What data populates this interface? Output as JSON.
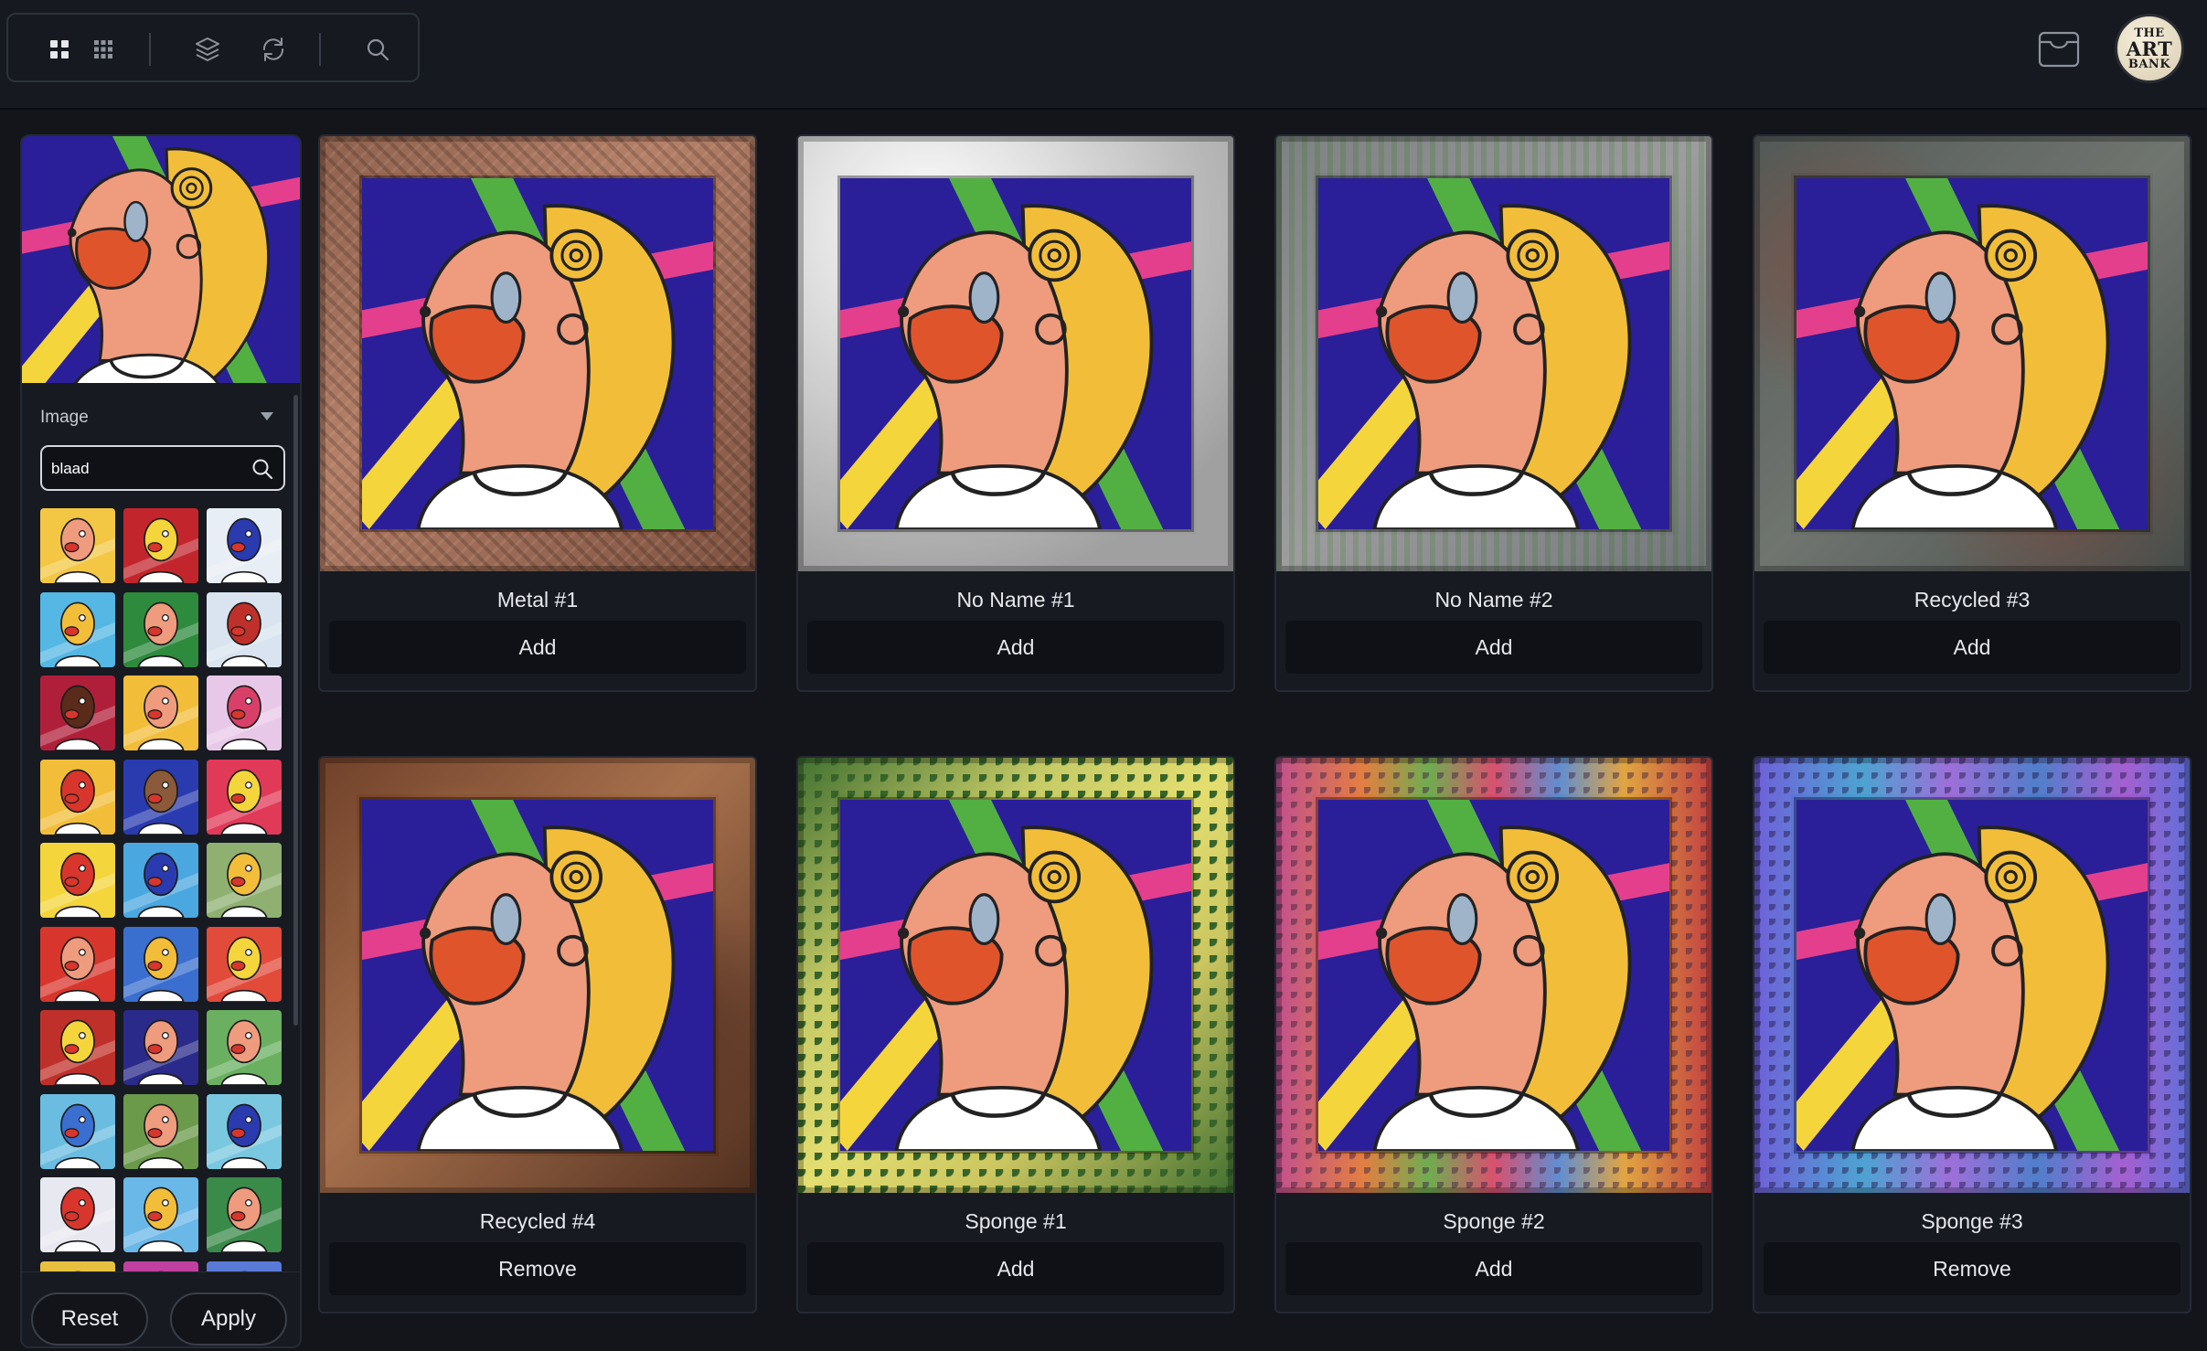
{
  "toolbar": {
    "icons": [
      "grid-large-icon",
      "grid-small-icon",
      "layers-icon",
      "refresh-icon",
      "search-icon"
    ]
  },
  "header": {
    "wallet_icon": "wallet-icon",
    "logo_lines": [
      "THE",
      "ART",
      "BANK"
    ]
  },
  "sidebar": {
    "section_label": "Image",
    "search": {
      "value": "blaad"
    },
    "reset_label": "Reset",
    "apply_label": "Apply"
  },
  "cards": [
    {
      "name": "Metal #1",
      "action": "Add"
    },
    {
      "name": "No Name #1",
      "action": "Add"
    },
    {
      "name": "No Name #2",
      "action": "Add"
    },
    {
      "name": "Recycled #3",
      "action": "Add"
    },
    {
      "name": "Recycled #4",
      "action": "Remove"
    },
    {
      "name": "Sponge #1",
      "action": "Add"
    },
    {
      "name": "Sponge #2",
      "action": "Add"
    },
    {
      "name": "Sponge #3",
      "action": "Remove"
    }
  ],
  "colors": {
    "background": "#13151b",
    "panel": "#171a21",
    "artwork_blue": "#2a1f98",
    "artwork_yellow": "#f2be3a",
    "artwork_skin": "#ef9b7e",
    "artwork_mouth": "#e0542c"
  }
}
